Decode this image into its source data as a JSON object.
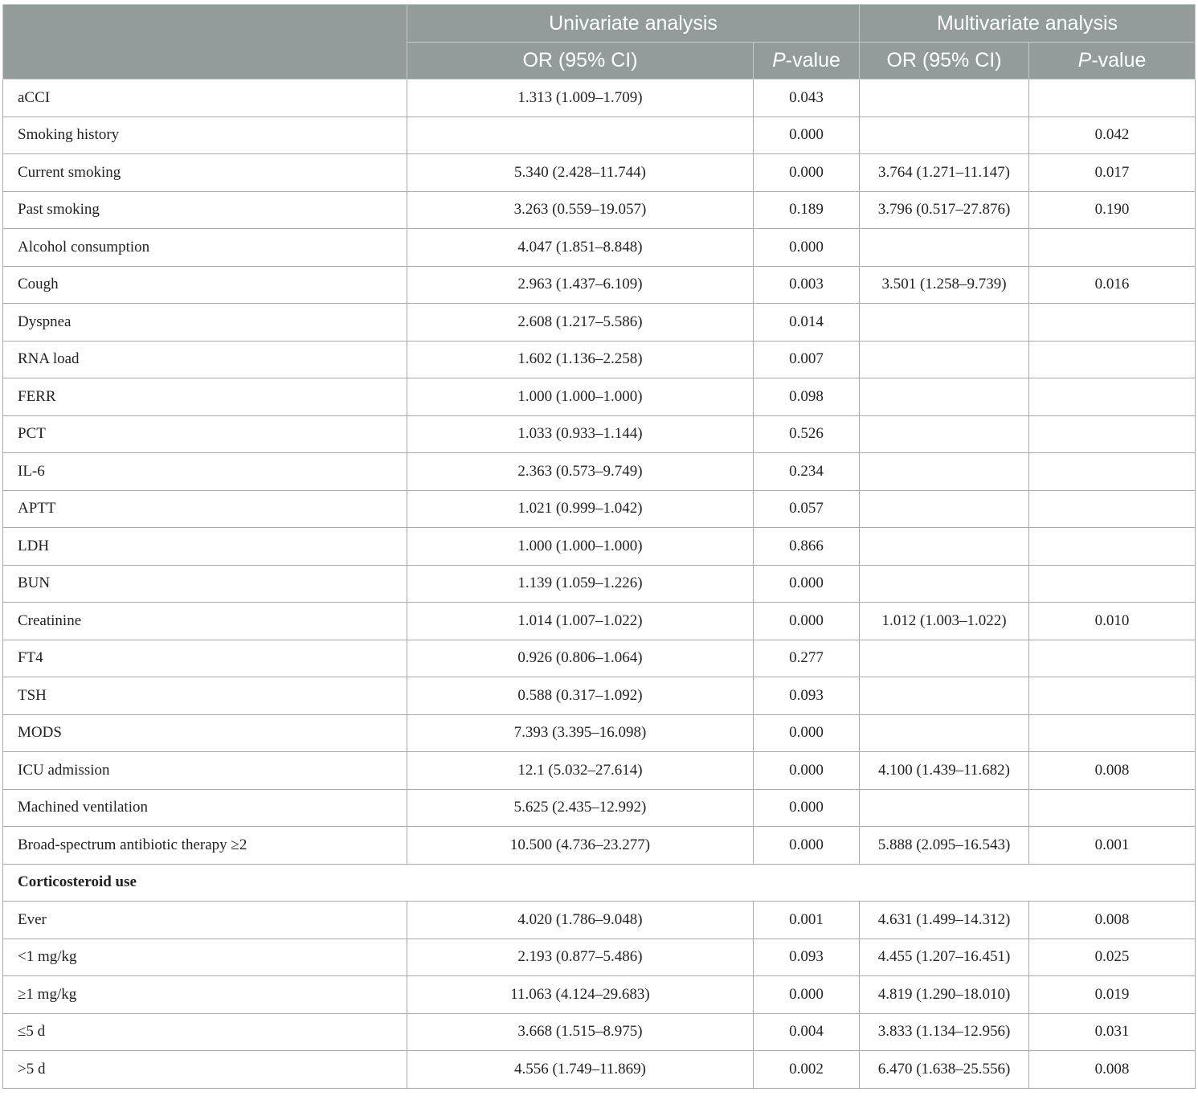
{
  "header": {
    "univariate_label": "Univariate analysis",
    "multivariate_label": "Multivariate analysis",
    "or_label": "OR (95% CI)",
    "p_italic": "P",
    "p_suffix": "-value"
  },
  "rows": [
    {
      "label": "aCCI",
      "uni_or": "1.313 (1.009–1.709)",
      "uni_p": "0.043",
      "multi_or": "",
      "multi_p": ""
    },
    {
      "label": "Smoking history",
      "uni_or": "",
      "uni_p": "0.000",
      "multi_or": "",
      "multi_p": "0.042"
    },
    {
      "label": "Current smoking",
      "uni_or": "5.340 (2.428–11.744)",
      "uni_p": "0.000",
      "multi_or": "3.764 (1.271–11.147)",
      "multi_p": "0.017"
    },
    {
      "label": "Past smoking",
      "uni_or": "3.263 (0.559–19.057)",
      "uni_p": "0.189",
      "multi_or": "3.796 (0.517–27.876)",
      "multi_p": "0.190"
    },
    {
      "label": "Alcohol consumption",
      "uni_or": "4.047 (1.851–8.848)",
      "uni_p": "0.000",
      "multi_or": "",
      "multi_p": ""
    },
    {
      "label": "Cough",
      "uni_or": "2.963 (1.437–6.109)",
      "uni_p": "0.003",
      "multi_or": "3.501 (1.258–9.739)",
      "multi_p": "0.016"
    },
    {
      "label": "Dyspnea",
      "uni_or": "2.608 (1.217–5.586)",
      "uni_p": "0.014",
      "multi_or": "",
      "multi_p": ""
    },
    {
      "label": "RNA load",
      "uni_or": "1.602 (1.136–2.258)",
      "uni_p": "0.007",
      "multi_or": "",
      "multi_p": ""
    },
    {
      "label": "FERR",
      "uni_or": "1.000 (1.000–1.000)",
      "uni_p": "0.098",
      "multi_or": "",
      "multi_p": ""
    },
    {
      "label": "PCT",
      "uni_or": "1.033 (0.933–1.144)",
      "uni_p": "0.526",
      "multi_or": "",
      "multi_p": ""
    },
    {
      "label": "IL-6",
      "uni_or": "2.363 (0.573–9.749)",
      "uni_p": "0.234",
      "multi_or": "",
      "multi_p": ""
    },
    {
      "label": "APTT",
      "uni_or": "1.021 (0.999–1.042)",
      "uni_p": "0.057",
      "multi_or": "",
      "multi_p": ""
    },
    {
      "label": "LDH",
      "uni_or": "1.000 (1.000–1.000)",
      "uni_p": "0.866",
      "multi_or": "",
      "multi_p": ""
    },
    {
      "label": "BUN",
      "uni_or": "1.139 (1.059–1.226)",
      "uni_p": "0.000",
      "multi_or": "",
      "multi_p": ""
    },
    {
      "label": "Creatinine",
      "uni_or": "1.014 (1.007–1.022)",
      "uni_p": "0.000",
      "multi_or": "1.012 (1.003–1.022)",
      "multi_p": "0.010"
    },
    {
      "label": "FT4",
      "uni_or": "0.926 (0.806–1.064)",
      "uni_p": "0.277",
      "multi_or": "",
      "multi_p": ""
    },
    {
      "label": "TSH",
      "uni_or": "0.588 (0.317–1.092)",
      "uni_p": "0.093",
      "multi_or": "",
      "multi_p": ""
    },
    {
      "label": "MODS",
      "uni_or": "7.393 (3.395–16.098)",
      "uni_p": "0.000",
      "multi_or": "",
      "multi_p": ""
    },
    {
      "label": "ICU admission",
      "uni_or": "12.1 (5.032–27.614)",
      "uni_p": "0.000",
      "multi_or": "4.100 (1.439–11.682)",
      "multi_p": "0.008"
    },
    {
      "label": "Machined ventilation",
      "uni_or": "5.625 (2.435–12.992)",
      "uni_p": "0.000",
      "multi_or": "",
      "multi_p": ""
    },
    {
      "label": "Broad-spectrum antibiotic therapy ≥2",
      "uni_or": "10.500 (4.736–23.277)",
      "uni_p": "0.000",
      "multi_or": "5.888 (2.095–16.543)",
      "multi_p": "0.001"
    }
  ],
  "section": {
    "title": "Corticosteroid use"
  },
  "section_rows": [
    {
      "label": "Ever",
      "uni_or": "4.020 (1.786–9.048)",
      "uni_p": "0.001",
      "multi_or": "4.631 (1.499–14.312)",
      "multi_p": "0.008"
    },
    {
      "label": "<1 mg/kg",
      "uni_or": "2.193 (0.877–5.486)",
      "uni_p": "0.093",
      "multi_or": "4.455 (1.207–16.451)",
      "multi_p": "0.025"
    },
    {
      "label": "≥1 mg/kg",
      "uni_or": "11.063 (4.124–29.683)",
      "uni_p": "0.000",
      "multi_or": "4.819 (1.290–18.010)",
      "multi_p": "0.019"
    },
    {
      "label": "≤5 d",
      "uni_or": "3.668 (1.515–8.975)",
      "uni_p": "0.004",
      "multi_or": "3.833 (1.134–12.956)",
      "multi_p": "0.031"
    },
    {
      "label": ">5 d",
      "uni_or": "4.556 (1.749–11.869)",
      "uni_p": "0.002",
      "multi_or": "6.470 (1.638–25.556)",
      "multi_p": "0.008"
    }
  ]
}
